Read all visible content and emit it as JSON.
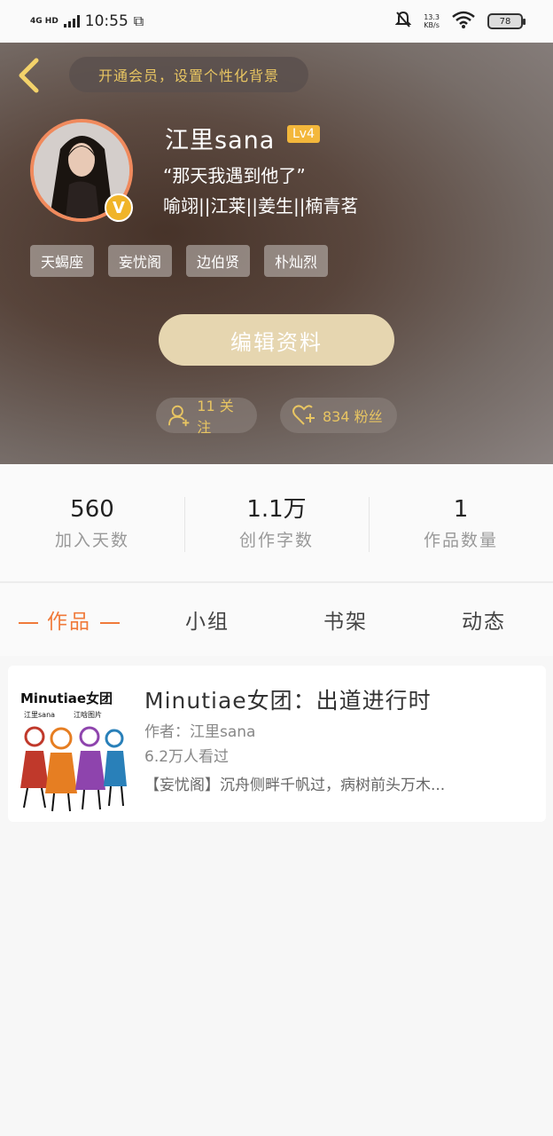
{
  "status_bar": {
    "network": "4G HD",
    "time": "10:55",
    "speed_value": "13.3",
    "speed_unit": "KB/s",
    "battery": "78"
  },
  "header": {
    "vip_banner": "开通会员，设置个性化背景",
    "username": "江里sana",
    "level": "Lv4",
    "verified_badge": "V",
    "bio_line1": "“那天我遇到他了”",
    "bio_line2": "喻翊||江莱||姜生||楠青茗",
    "tags": [
      "天蝎座",
      "妄忧阁",
      "边伯贤",
      "朴灿烈"
    ],
    "edit_button": "编辑资料",
    "following": "11 关注",
    "fans": "834 粉丝"
  },
  "stats": [
    {
      "value": "560",
      "label": "加入天数"
    },
    {
      "value": "1.1万",
      "label": "创作字数"
    },
    {
      "value": "1",
      "label": "作品数量"
    }
  ],
  "tabs": [
    {
      "label": "作品",
      "active": true
    },
    {
      "label": "小组",
      "active": false
    },
    {
      "label": "书架",
      "active": false
    },
    {
      "label": "动态",
      "active": false
    }
  ],
  "works": [
    {
      "cover_text": "Minutiae女团",
      "cover_subtext1": "江里sana",
      "cover_subtext2": "江晗图片",
      "title": "Minutiae女团：出道进行时",
      "author": "作者：江里sana",
      "views": "6.2万人看过",
      "description": "【妄忧阁】沉舟侧畔千帆过，病树前头万木..."
    }
  ],
  "colors": {
    "accent": "#f07a3a",
    "gold": "#e8c562",
    "level_badge": "#f3b73b",
    "edit_button_bg": "#e6d6b0"
  }
}
